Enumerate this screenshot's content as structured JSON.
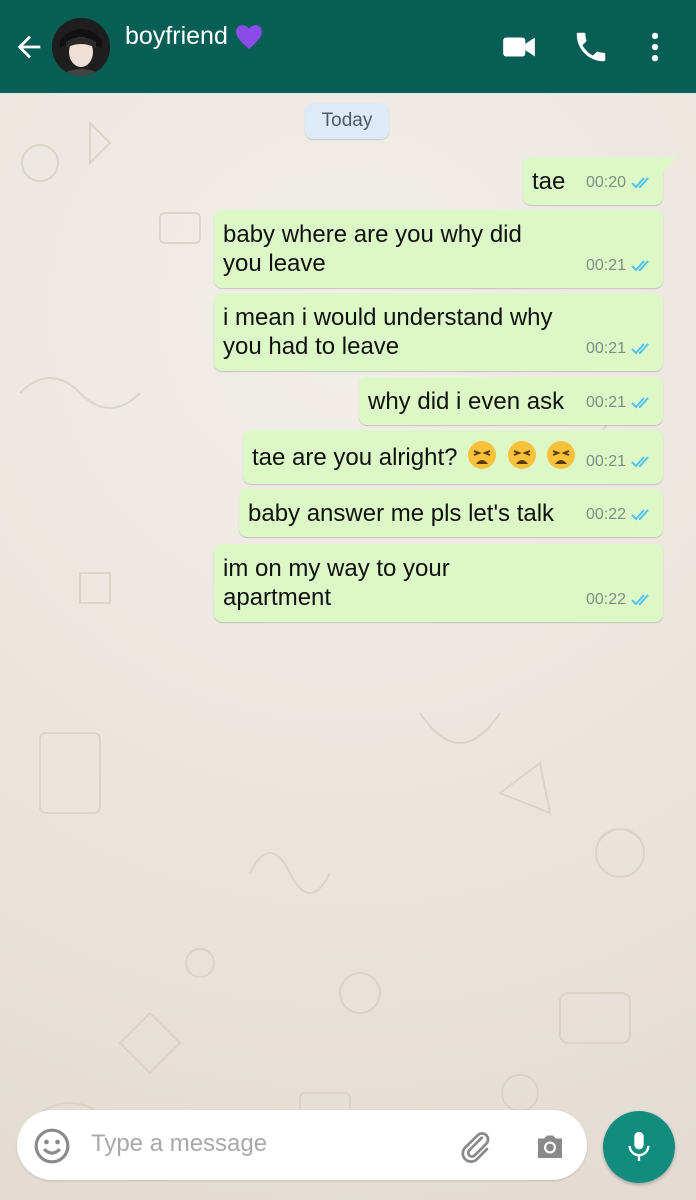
{
  "header": {
    "contact_name": "boyfriend",
    "icons": [
      "back-arrow-icon",
      "avatar",
      "purple-heart-icon",
      "video-call-icon",
      "phone-icon",
      "more-vert-icon"
    ]
  },
  "chat": {
    "date_label": "Today",
    "messages": [
      {
        "text": "tae",
        "time": "00:20",
        "status": "read"
      },
      {
        "text": "baby where are you why did\nyou leave",
        "time": "00:21",
        "status": "read"
      },
      {
        "text": "i mean i would understand why\nyou had to leave",
        "time": "00:21",
        "status": "read"
      },
      {
        "text": "why did i even ask",
        "time": "00:21",
        "status": "read"
      },
      {
        "text": "tae are you alright?",
        "emoji": [
          "tired-face",
          "tired-face",
          "tired-face"
        ],
        "time": "00:21",
        "status": "read"
      },
      {
        "text": "baby answer me pls let's talk",
        "time": "00:22",
        "status": "read"
      },
      {
        "text": "im on my way to your\napartment",
        "time": "00:22",
        "status": "read"
      }
    ]
  },
  "composer": {
    "placeholder": "Type a message",
    "icons": [
      "emoji-icon",
      "attach-icon",
      "camera-icon",
      "mic-icon"
    ]
  },
  "colors": {
    "header": "#075e54",
    "outgoing_bubble": "#dcf8c6",
    "read_ticks": "#4fc3f7",
    "mic_button": "#128c7e",
    "heart": "#8a4be8"
  }
}
